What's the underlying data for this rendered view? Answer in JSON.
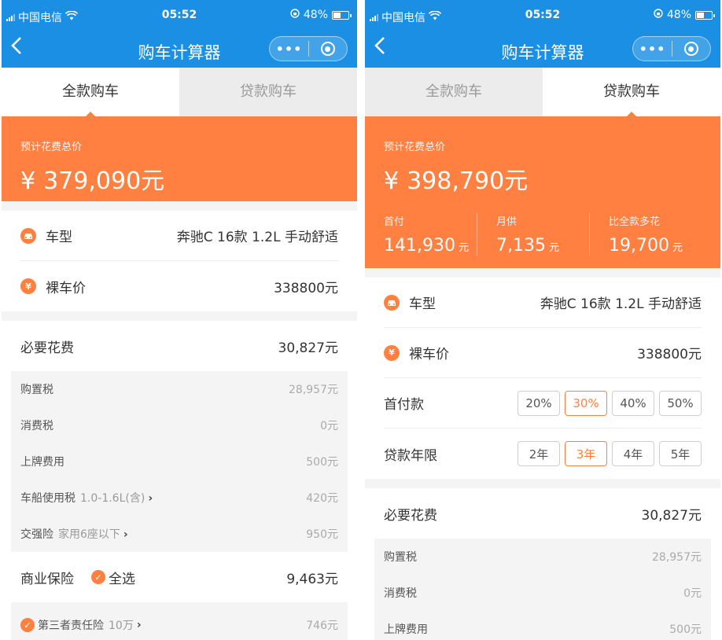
{
  "status": {
    "carrier": "中国电信",
    "time": "05:52",
    "battery": "48%"
  },
  "nav": {
    "title": "购车计算器",
    "more": "•••"
  },
  "tabs": [
    "全款购车",
    "贷款购车"
  ],
  "full": {
    "hero_label": "预计花费总价",
    "currency": "¥",
    "total": "379,090元",
    "car_label": "车型",
    "car_value": "奔驰C 16款 1.2L 手动舒适",
    "price_label": "裸车价",
    "price_value": "338800元",
    "required_label": "必要花费",
    "required_value": "30,827元",
    "fees": [
      {
        "label": "购置税",
        "hint": "",
        "value": "28,957元"
      },
      {
        "label": "消费税",
        "hint": "",
        "value": "0元"
      },
      {
        "label": "上牌费用",
        "hint": "",
        "value": "500元"
      },
      {
        "label": "车船使用税",
        "hint": "1.0-1.6L(含)",
        "value": "420元"
      },
      {
        "label": "交强险",
        "hint": "家用6座以下",
        "value": "950元"
      }
    ],
    "insurance_label": "商业保险",
    "select_all": "全选",
    "insurance_value": "9,463元",
    "third_party_label": "第三者责任险",
    "third_party_hint": "10万",
    "third_party_value": "746元"
  },
  "loan": {
    "hero_label": "预计花费总价",
    "currency": "¥",
    "total": "398,790元",
    "stats": [
      {
        "label": "首付",
        "value": "141,930",
        "unit": "元"
      },
      {
        "label": "月供",
        "value": "7,135",
        "unit": "元"
      },
      {
        "label": "比全款多花",
        "value": "19,700",
        "unit": "元"
      }
    ],
    "car_label": "车型",
    "car_value": "奔驰C 16款 1.2L 手动舒适",
    "price_label": "裸车价",
    "price_value": "338800元",
    "down_label": "首付款",
    "down_options": [
      "20%",
      "30%",
      "40%",
      "50%"
    ],
    "down_selected": "30%",
    "term_label": "贷款年限",
    "term_options": [
      "2年",
      "3年",
      "4年",
      "5年"
    ],
    "term_selected": "3年",
    "required_label": "必要花费",
    "required_value": "30,827元",
    "fees": [
      {
        "label": "购置税",
        "value": "28,957元"
      },
      {
        "label": "消费税",
        "value": "0元"
      },
      {
        "label": "上牌费用",
        "value": "500元"
      }
    ]
  },
  "colors": {
    "brand_blue": "#1a8fe3",
    "accent_orange": "#ff8040"
  },
  "icons": {
    "car": "car-icon",
    "yen": "yen-icon",
    "check": "check-icon"
  }
}
